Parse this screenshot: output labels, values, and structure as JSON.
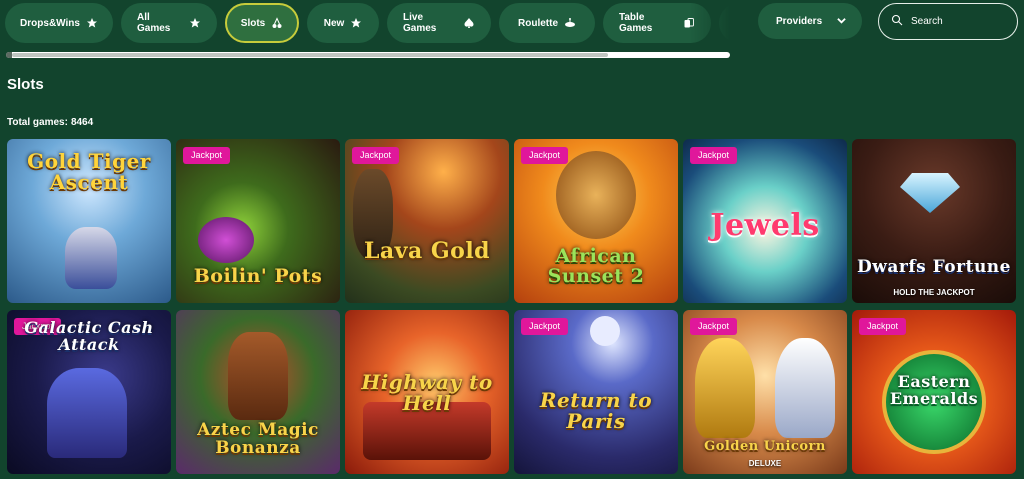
{
  "categories": [
    {
      "label": "Drops&Wins",
      "icon": "star-icon",
      "active": false
    },
    {
      "label": "All Games",
      "icon": "star-icon",
      "active": false
    },
    {
      "label": "Slots",
      "icon": "cherries-icon",
      "active": true
    },
    {
      "label": "New",
      "icon": "star-icon",
      "active": false
    },
    {
      "label": "Live Games",
      "icon": "spade-icon",
      "active": false
    },
    {
      "label": "Roulette",
      "icon": "roulette-icon",
      "active": false
    },
    {
      "label": "Table Games",
      "icon": "cards-icon",
      "active": false
    }
  ],
  "providers": {
    "label": "Providers",
    "icon": "chevron-down-icon"
  },
  "search": {
    "placeholder": "Search",
    "value": "",
    "icon": "search-icon"
  },
  "section": {
    "title": "Slots",
    "total_label": "Total games:",
    "total_count": "8464"
  },
  "colors": {
    "background": "#12442d",
    "chip": "#1f5e3f",
    "active_border": "#c7cc3b",
    "jackpot_badge": "#e0179b"
  },
  "games": [
    {
      "title": "Gold Tiger Ascent",
      "jackpot": false
    },
    {
      "title": "Boilin' Pots",
      "jackpot": true
    },
    {
      "title": "Lava Gold",
      "jackpot": true
    },
    {
      "title": "African Sunset 2",
      "jackpot": true
    },
    {
      "title": "Jewels",
      "jackpot": true
    },
    {
      "title": "Dwarfs Fortune",
      "subtitle": "HOLD THE JACKPOT",
      "jackpot": false
    },
    {
      "title": "Galactic Cash Attack",
      "jackpot": true
    },
    {
      "title": "Aztec Magic Bonanza",
      "jackpot": false
    },
    {
      "title": "Highway to Hell",
      "jackpot": false
    },
    {
      "title": "Return to Paris",
      "jackpot": true
    },
    {
      "title": "Golden Unicorn",
      "subtitle": "DELUXE",
      "jackpot": true
    },
    {
      "title": "Eastern Emeralds",
      "jackpot": true
    }
  ],
  "jackpot_label": "Jackpot"
}
